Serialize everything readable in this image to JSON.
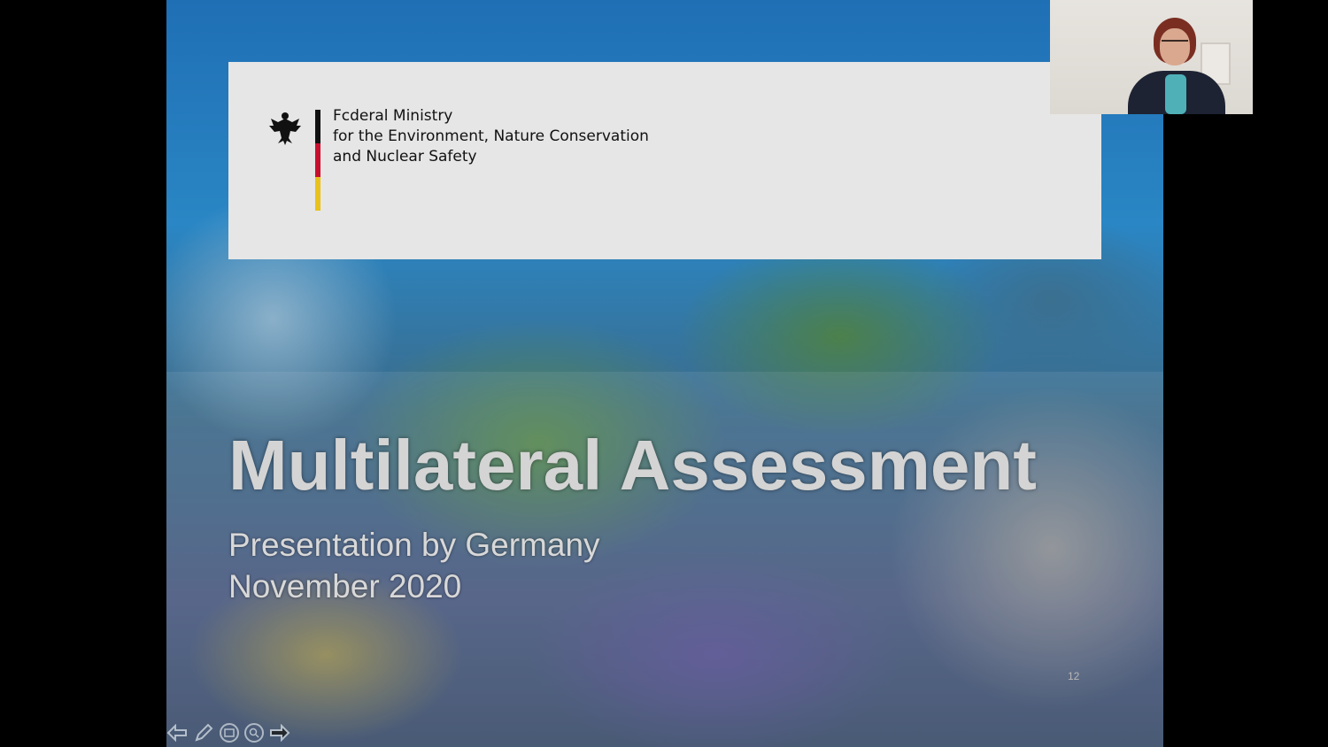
{
  "slide": {
    "ministry_lines": [
      "Fcderal Ministry",
      "for the Environment, Nature Conservation",
      "and Nuclear Safety"
    ],
    "title": "Multilateral Assessment",
    "subtitle_lines": [
      "Presentation by Germany",
      "November 2020"
    ],
    "slide_number": "12",
    "flag_colors": [
      "#111111",
      "#c8102e",
      "#e8c21a"
    ]
  },
  "toolbar": {
    "buttons": [
      {
        "name": "previous-slide-button",
        "icon": "arrow-left-icon"
      },
      {
        "name": "pen-tool-button",
        "icon": "pen-icon"
      },
      {
        "name": "slides-view-button",
        "icon": "slides-icon"
      },
      {
        "name": "zoom-button",
        "icon": "zoom-icon"
      },
      {
        "name": "next-slide-button",
        "icon": "arrow-right-icon"
      }
    ]
  },
  "webcam": {
    "icon": "webcam-feed"
  }
}
